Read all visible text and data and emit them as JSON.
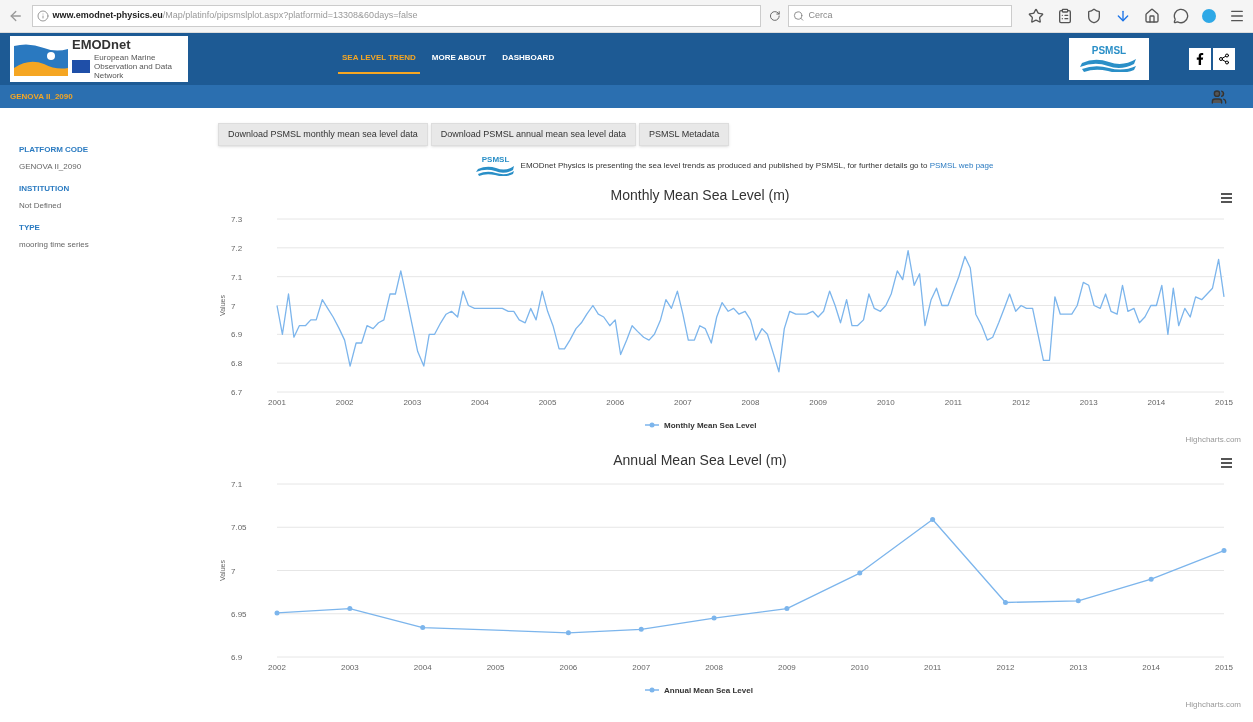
{
  "browser": {
    "url_host": "www.emodnet-physics.eu",
    "url_path": "/Map/platinfo/pipsmslplot.aspx?platformid=13308&60days=false",
    "search_placeholder": "Cerca"
  },
  "header": {
    "logo_text": "EMODnet",
    "logo_subtext": "European Marine Observation and Data Network",
    "nav": [
      {
        "label": "SEA LEVEL TREND",
        "selected": true
      },
      {
        "label": "MORE ABOUT",
        "selected": false
      },
      {
        "label": "DASHBOARD",
        "selected": false
      }
    ],
    "partner_logo_text": "PSMSL"
  },
  "platform_bar": {
    "title": "GENOVA II_2090"
  },
  "sidebar": {
    "fields": [
      {
        "label": "PLATFORM CODE",
        "value": "GENOVA II_2090"
      },
      {
        "label": "INSTITUTION",
        "value": "Not Defined"
      },
      {
        "label": "TYPE",
        "value": "mooring time series"
      }
    ]
  },
  "actions": [
    "Download PSMSL monthly mean sea level data",
    "Download PSMSL annual mean sea level data",
    "PSMSL Metadata"
  ],
  "notice": {
    "logo_text": "PSMSL",
    "text": "EMODnet Physics is presenting the sea level trends as produced and published by PSMSL, for further details go to",
    "link": "PSMSL web page"
  },
  "charts": [
    {
      "credit": "Highcharts.com",
      "point_markers": false,
      "chart_data": {
        "type": "line",
        "title": "Monthly Mean Sea Level (m)",
        "ylabel": "Values",
        "grid": true,
        "xlim": [
          2001,
          2015
        ],
        "xticks": [
          2001,
          2002,
          2003,
          2004,
          2005,
          2006,
          2007,
          2008,
          2009,
          2010,
          2011,
          2012,
          2013,
          2014,
          2015
        ],
        "ylim": [
          6.7,
          7.3
        ],
        "x": [
          2001,
          2001.08,
          2001.17,
          2001.25,
          2001.33,
          2001.42,
          2001.5,
          2001.58,
          2001.67,
          2001.75,
          2001.83,
          2001.92,
          2002,
          2002.08,
          2002.17,
          2002.25,
          2002.33,
          2002.42,
          2002.5,
          2002.58,
          2002.67,
          2002.75,
          2002.83,
          2002.92,
          2003,
          2003.08,
          2003.17,
          2003.25,
          2003.33,
          2003.42,
          2003.5,
          2003.58,
          2003.67,
          2003.75,
          2003.83,
          2003.92,
          2004,
          2004.08,
          2004.17,
          2004.25,
          2004.33,
          2004.42,
          2004.5,
          2004.58,
          2004.67,
          2004.75,
          2004.83,
          2004.92,
          2005,
          2005.08,
          2005.17,
          2005.25,
          2005.33,
          2005.42,
          2005.5,
          2005.58,
          2005.67,
          2005.75,
          2005.83,
          2005.92,
          2006,
          2006.08,
          2006.17,
          2006.25,
          2006.33,
          2006.42,
          2006.5,
          2006.58,
          2006.67,
          2006.75,
          2006.83,
          2006.92,
          2007,
          2007.08,
          2007.17,
          2007.25,
          2007.33,
          2007.42,
          2007.5,
          2007.58,
          2007.67,
          2007.75,
          2007.83,
          2007.92,
          2008,
          2008.08,
          2008.17,
          2008.25,
          2008.33,
          2008.42,
          2008.5,
          2008.58,
          2008.67,
          2008.75,
          2008.83,
          2008.92,
          2009,
          2009.08,
          2009.17,
          2009.25,
          2009.33,
          2009.42,
          2009.5,
          2009.58,
          2009.67,
          2009.75,
          2009.83,
          2009.92,
          2010,
          2010.08,
          2010.17,
          2010.25,
          2010.33,
          2010.42,
          2010.5,
          2010.58,
          2010.67,
          2010.75,
          2010.83,
          2010.92,
          2011,
          2011.08,
          2011.17,
          2011.25,
          2011.33,
          2011.42,
          2011.5,
          2011.58,
          2011.67,
          2011.75,
          2011.83,
          2011.92,
          2012,
          2012.08,
          2012.17,
          2012.25,
          2012.33,
          2012.42,
          2012.5,
          2012.58,
          2012.67,
          2012.75,
          2012.83,
          2012.92,
          2013,
          2013.08,
          2013.17,
          2013.25,
          2013.33,
          2013.42,
          2013.5,
          2013.58,
          2013.67,
          2013.75,
          2013.83,
          2013.92,
          2014,
          2014.08,
          2014.17,
          2014.25,
          2014.33,
          2014.42,
          2014.5,
          2014.58,
          2014.67,
          2014.75,
          2014.83,
          2014.92,
          2015
        ],
        "yticks": [
          6.7,
          6.8,
          6.9,
          7,
          7.1,
          7.2,
          7.3
        ],
        "series": [
          {
            "name": "Monthly Mean Sea Level",
            "color": "#7cb5ec",
            "values": [
              7.0,
              6.9,
              7.04,
              6.89,
              6.93,
              6.93,
              6.95,
              6.95,
              7.02,
              6.99,
              6.96,
              6.92,
              6.88,
              6.79,
              6.87,
              6.87,
              6.93,
              6.92,
              6.94,
              6.95,
              7.04,
              7.04,
              7.12,
              7.02,
              6.93,
              6.84,
              6.79,
              6.9,
              6.9,
              6.94,
              6.97,
              6.98,
              6.96,
              7.05,
              7.0,
              6.99,
              6.99,
              6.99,
              6.99,
              6.99,
              6.99,
              6.98,
              6.98,
              6.95,
              6.94,
              6.99,
              6.95,
              7.05,
              6.98,
              6.93,
              6.85,
              6.85,
              6.88,
              6.92,
              6.94,
              6.97,
              7.0,
              6.97,
              6.96,
              6.93,
              6.95,
              6.83,
              6.88,
              6.93,
              6.91,
              6.89,
              6.88,
              6.9,
              6.95,
              7.02,
              6.99,
              7.05,
              6.97,
              6.88,
              6.88,
              6.93,
              6.92,
              6.87,
              6.96,
              7.01,
              6.98,
              6.99,
              6.97,
              6.98,
              6.95,
              6.88,
              6.92,
              6.9,
              6.84,
              6.77,
              6.92,
              6.98,
              6.97,
              6.97,
              6.97,
              6.98,
              6.96,
              6.98,
              7.05,
              7.0,
              6.94,
              7.02,
              6.93,
              6.93,
              6.95,
              7.04,
              6.99,
              6.98,
              7.0,
              7.04,
              7.12,
              7.09,
              7.19,
              7.07,
              7.11,
              6.93,
              7.02,
              7.06,
              7.0,
              7.0,
              7.05,
              7.1,
              7.17,
              7.13,
              6.97,
              6.93,
              6.88,
              6.89,
              6.94,
              6.99,
              7.04,
              6.98,
              7.0,
              6.99,
              6.99,
              6.9,
              6.81,
              6.81,
              7.03,
              6.97,
              6.97,
              6.97,
              7.0,
              7.08,
              7.07,
              7.0,
              6.99,
              7.04,
              6.98,
              6.97,
              7.07,
              6.98,
              6.99,
              6.94,
              6.96,
              7.0,
              7.0,
              7.07,
              6.9,
              7.06,
              6.93,
              6.99,
              6.96,
              7.03,
              7.02,
              7.04,
              7.06,
              7.16,
              7.03
            ]
          }
        ]
      }
    },
    {
      "credit": "Highcharts.com",
      "point_markers": true,
      "chart_data": {
        "type": "line",
        "title": "Annual Mean Sea Level (m)",
        "ylabel": "Values",
        "grid": true,
        "x": [
          2002,
          2003,
          2004,
          2006,
          2007,
          2008,
          2009,
          2010,
          2011,
          2012,
          2013,
          2014,
          2015
        ],
        "xlim": [
          2002,
          2015
        ],
        "ylim": [
          6.9,
          7.1
        ],
        "xticks": [
          2002,
          2003,
          2004,
          2005,
          2006,
          2007,
          2008,
          2009,
          2010,
          2011,
          2012,
          2013,
          2014,
          2015
        ],
        "yticks": [
          6.9,
          6.95,
          7,
          7.05,
          7.1
        ],
        "series": [
          {
            "name": "Annual Mean Sea Level",
            "color": "#7cb5ec",
            "values": [
              6.951,
              6.956,
              6.934,
              6.928,
              6.932,
              6.945,
              6.956,
              6.997,
              7.059,
              6.963,
              6.965,
              6.99,
              7.023
            ]
          }
        ]
      }
    }
  ]
}
